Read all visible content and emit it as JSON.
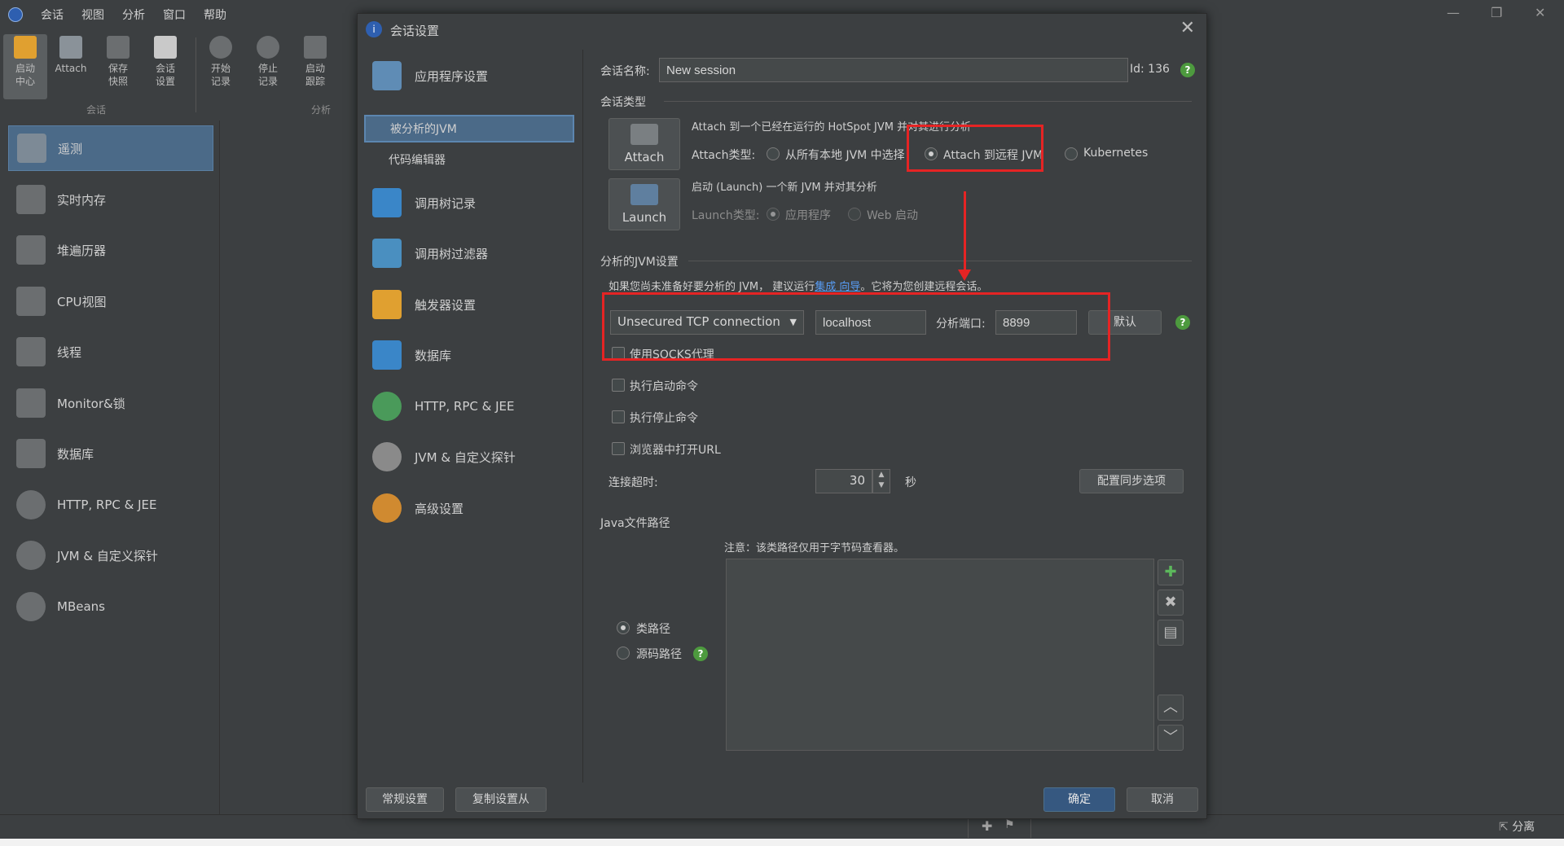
{
  "menubar": {
    "items": [
      "会话",
      "视图",
      "分析",
      "窗口",
      "帮助"
    ],
    "window_controls": [
      "—",
      "❐",
      "✕"
    ]
  },
  "toolbar": {
    "buttons": [
      {
        "label": "启动\n中心",
        "icon": "launch-center-icon"
      },
      {
        "label": "Attach",
        "icon": "attach-icon"
      },
      {
        "label": "保存\n快照",
        "icon": "save-snapshot-icon"
      },
      {
        "label": "会话\n设置",
        "icon": "session-settings-icon"
      },
      {
        "label": "开始\n记录",
        "icon": "start-recording-icon"
      },
      {
        "label": "停止\n记录",
        "icon": "stop-recording-icon"
      },
      {
        "label": "启动\n跟踪",
        "icon": "start-tracking-icon"
      }
    ],
    "groups": [
      "会话",
      "分析"
    ]
  },
  "leftnav": {
    "items": [
      "遥测",
      "实时内存",
      "堆遍历器",
      "CPU视图",
      "线程",
      "Monitor&锁",
      "数据库",
      "HTTP, RPC & JEE",
      "JVM & 自定义探针",
      "MBeans"
    ]
  },
  "statusbar": {
    "right_label": "分离"
  },
  "dialog": {
    "title": "会话设置",
    "categories": [
      {
        "label": "应用程序设置",
        "icon": "app-settings-icon",
        "color": "#5f8cb5"
      },
      {
        "label": "被分析的JVM",
        "sub": true,
        "selected": true
      },
      {
        "label": "代码编辑器",
        "sub": true
      },
      {
        "label": "调用树记录",
        "icon": "call-tree-icon",
        "color": "#3a86c8"
      },
      {
        "label": "调用树过滤器",
        "icon": "filter-icon",
        "color": "#4a8fc0"
      },
      {
        "label": "触发器设置",
        "icon": "trigger-flag-icon",
        "color": "#e0a030"
      },
      {
        "label": "数据库",
        "icon": "database-icon",
        "color": "#3a86c8"
      },
      {
        "label": "HTTP, RPC & JEE",
        "icon": "globe-icon",
        "color": "#4a9a5a"
      },
      {
        "label": "JVM & 自定义探针",
        "icon": "gauge-icon",
        "color": "#8a8a8a"
      },
      {
        "label": "高级设置",
        "icon": "gears-icon",
        "color": "#d08a30"
      }
    ],
    "session_name_label": "会话名称:",
    "session_name_value": "New session",
    "id_label": "Id: 136",
    "session_type_label": "会话类型",
    "attach": {
      "button": "Attach",
      "desc": "Attach 到一个已经在运行的 HotSpot JVM 并对其进行分析",
      "type_label": "Attach类型:",
      "options": [
        "从所有本地 JVM 中选择",
        "Attach 到远程 JVM",
        "Kubernetes"
      ],
      "selected": 1
    },
    "launch": {
      "button": "Launch",
      "desc": "启动 (Launch) 一个新 JVM 并对其分析",
      "type_label": "Launch类型:",
      "options": [
        "应用程序",
        "Web 启动"
      ],
      "selected": 0
    },
    "jvm_settings_label": "分析的JVM设置",
    "hint_prefix": "如果您尚未准备好要分析的 JVM， 建议运行",
    "hint_link": "集成 向导",
    "hint_suffix": "。它将为您创建远程会话。",
    "connection_type": "Unsecured TCP connection",
    "host": "localhost",
    "port_label": "分析端口:",
    "port": "8899",
    "default_button": "默认",
    "socks_label": "使用SOCKS代理",
    "checkboxes": [
      "执行启动命令",
      "执行停止命令",
      "浏览器中打开URL"
    ],
    "timeout_label": "连接超时:",
    "timeout_value": "30",
    "timeout_unit": "秒",
    "sync_button": "配置同步选项",
    "java_path_label": "Java文件路径",
    "java_path_note": "注意：该类路径仅用于字节码查看器。",
    "path_options": [
      "类路径",
      "源码路径"
    ],
    "path_selected": 0,
    "footer": {
      "general_button": "常规设置",
      "copy_button": "复制设置从",
      "ok_button": "确定",
      "cancel_button": "取消"
    }
  }
}
